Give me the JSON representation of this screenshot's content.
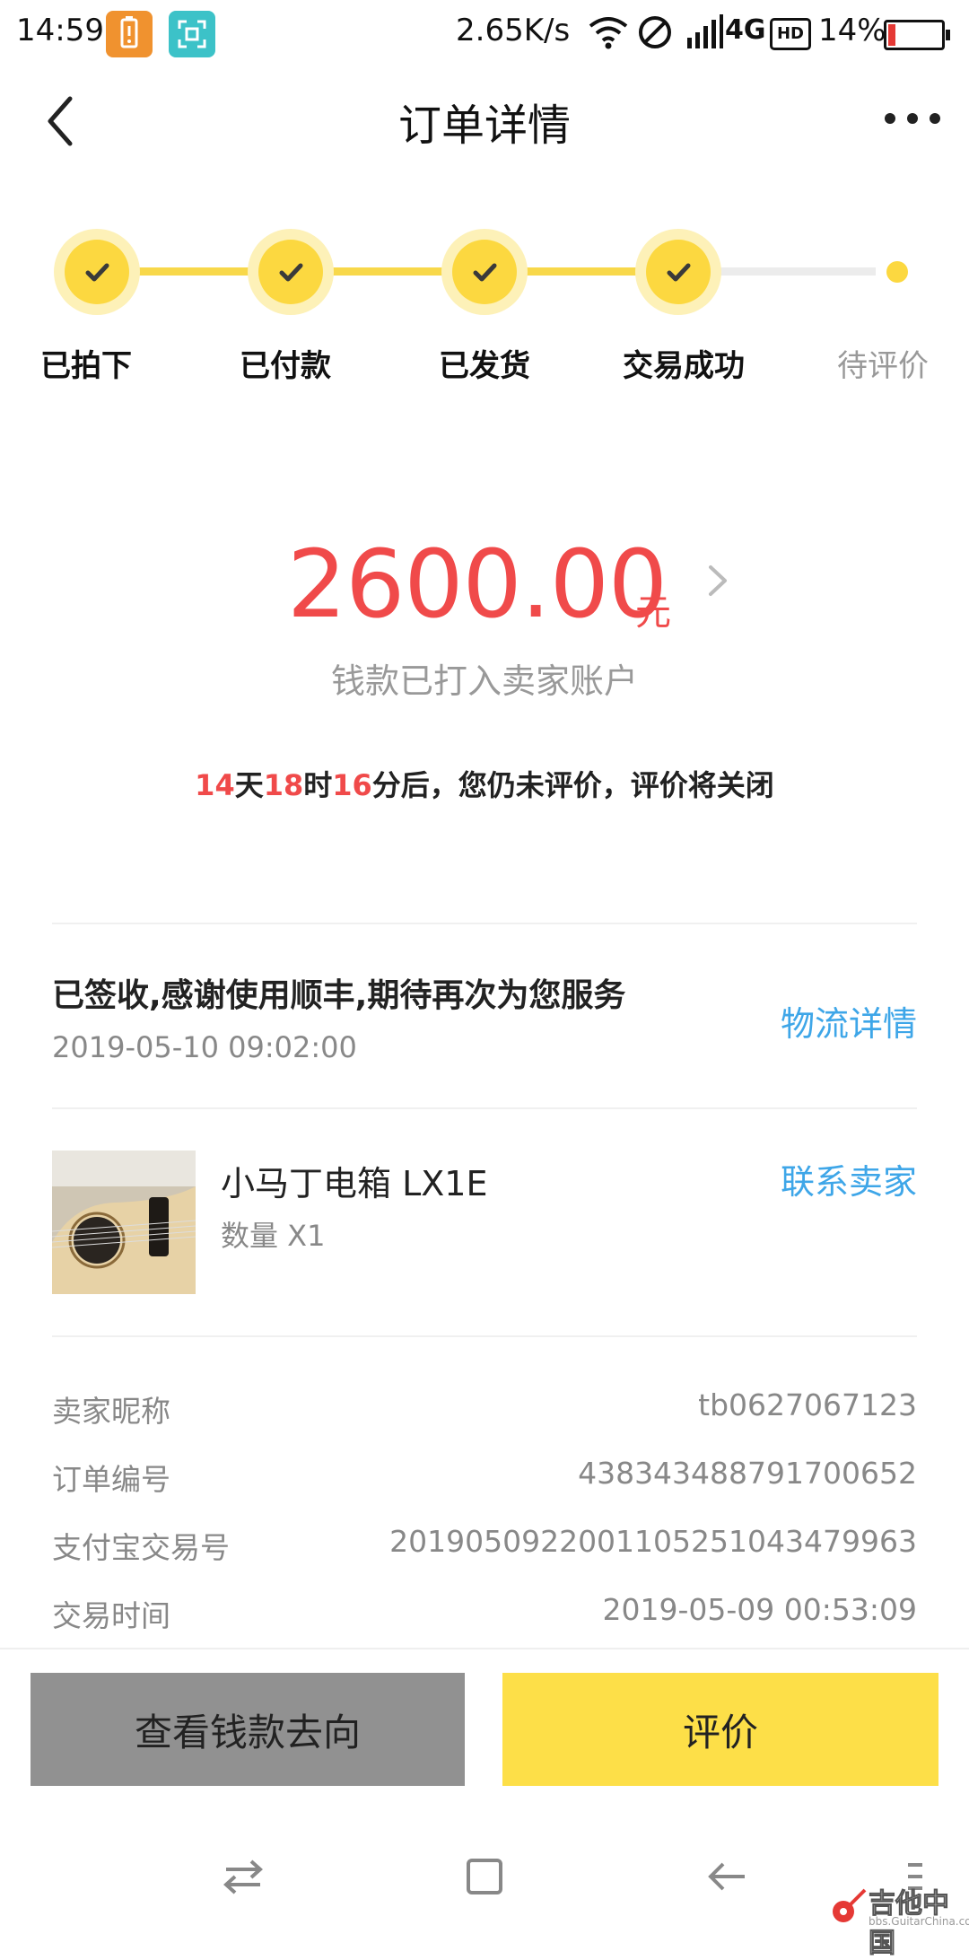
{
  "status_bar": {
    "time": "14:59",
    "speed": "2.65K/s",
    "network": "4G",
    "hd": "HD",
    "battery_percent": "14%",
    "battery_level": 0.14
  },
  "header": {
    "title": "订单详情"
  },
  "progress": {
    "steps": [
      {
        "label": "已拍下",
        "done": true
      },
      {
        "label": "已付款",
        "done": true
      },
      {
        "label": "已发货",
        "done": true
      },
      {
        "label": "交易成功",
        "done": true
      },
      {
        "label": "待评价",
        "done": false
      }
    ]
  },
  "payment": {
    "amount": "2600.00",
    "unit": "元",
    "status": "钱款已打入卖家账户"
  },
  "countdown": {
    "days": "14",
    "days_unit": "天",
    "hours": "18",
    "hours_unit": "时",
    "minutes": "16",
    "message": "分后，您仍未评价，评价将关闭"
  },
  "logistics": {
    "status": "已签收,感谢使用顺丰,期待再次为您服务",
    "time": "2019-05-10 09:02:00",
    "link_label": "物流详情"
  },
  "product": {
    "name": "小马丁电箱 LX1E",
    "quantity": "数量 X1",
    "contact_label": "联系卖家"
  },
  "order_info": [
    {
      "label": "卖家昵称",
      "value": "tb0627067123"
    },
    {
      "label": "订单编号",
      "value": "438343488791700652"
    },
    {
      "label": "支付宝交易号",
      "value": "2019050922001105251043479963"
    },
    {
      "label": "交易时间",
      "value": "2019-05-09 00:53:09"
    }
  ],
  "actions": {
    "view_flow_label": "查看钱款去向",
    "rate_label": "评价"
  },
  "watermark": {
    "text": "吉他中国",
    "sub": "bbs.GuitarChina.com"
  },
  "colors": {
    "accent_yellow": "#fcd840",
    "price_red": "#f04a4a",
    "link_blue": "#3ea6e8"
  }
}
